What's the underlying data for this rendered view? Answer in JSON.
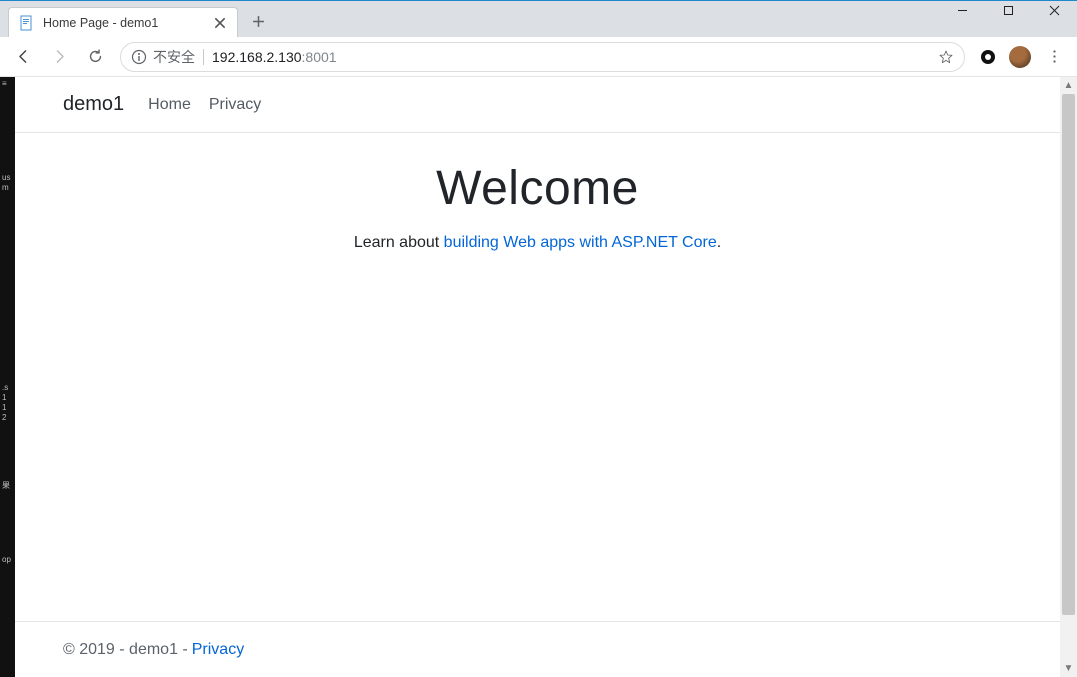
{
  "browser": {
    "tab": {
      "title": "Home Page - demo1"
    },
    "insecure_label": "不安全",
    "url_host": "192.168.2.130",
    "url_port": ":8001"
  },
  "site": {
    "brand": "demo1",
    "nav": {
      "home": "Home",
      "privacy": "Privacy"
    }
  },
  "hero": {
    "title": "Welcome",
    "lead_prefix": "Learn about ",
    "lead_link": "building Web apps with ASP.NET Core",
    "lead_suffix": "."
  },
  "footer": {
    "text": "© 2019 - demo1 - ",
    "link": "Privacy"
  }
}
